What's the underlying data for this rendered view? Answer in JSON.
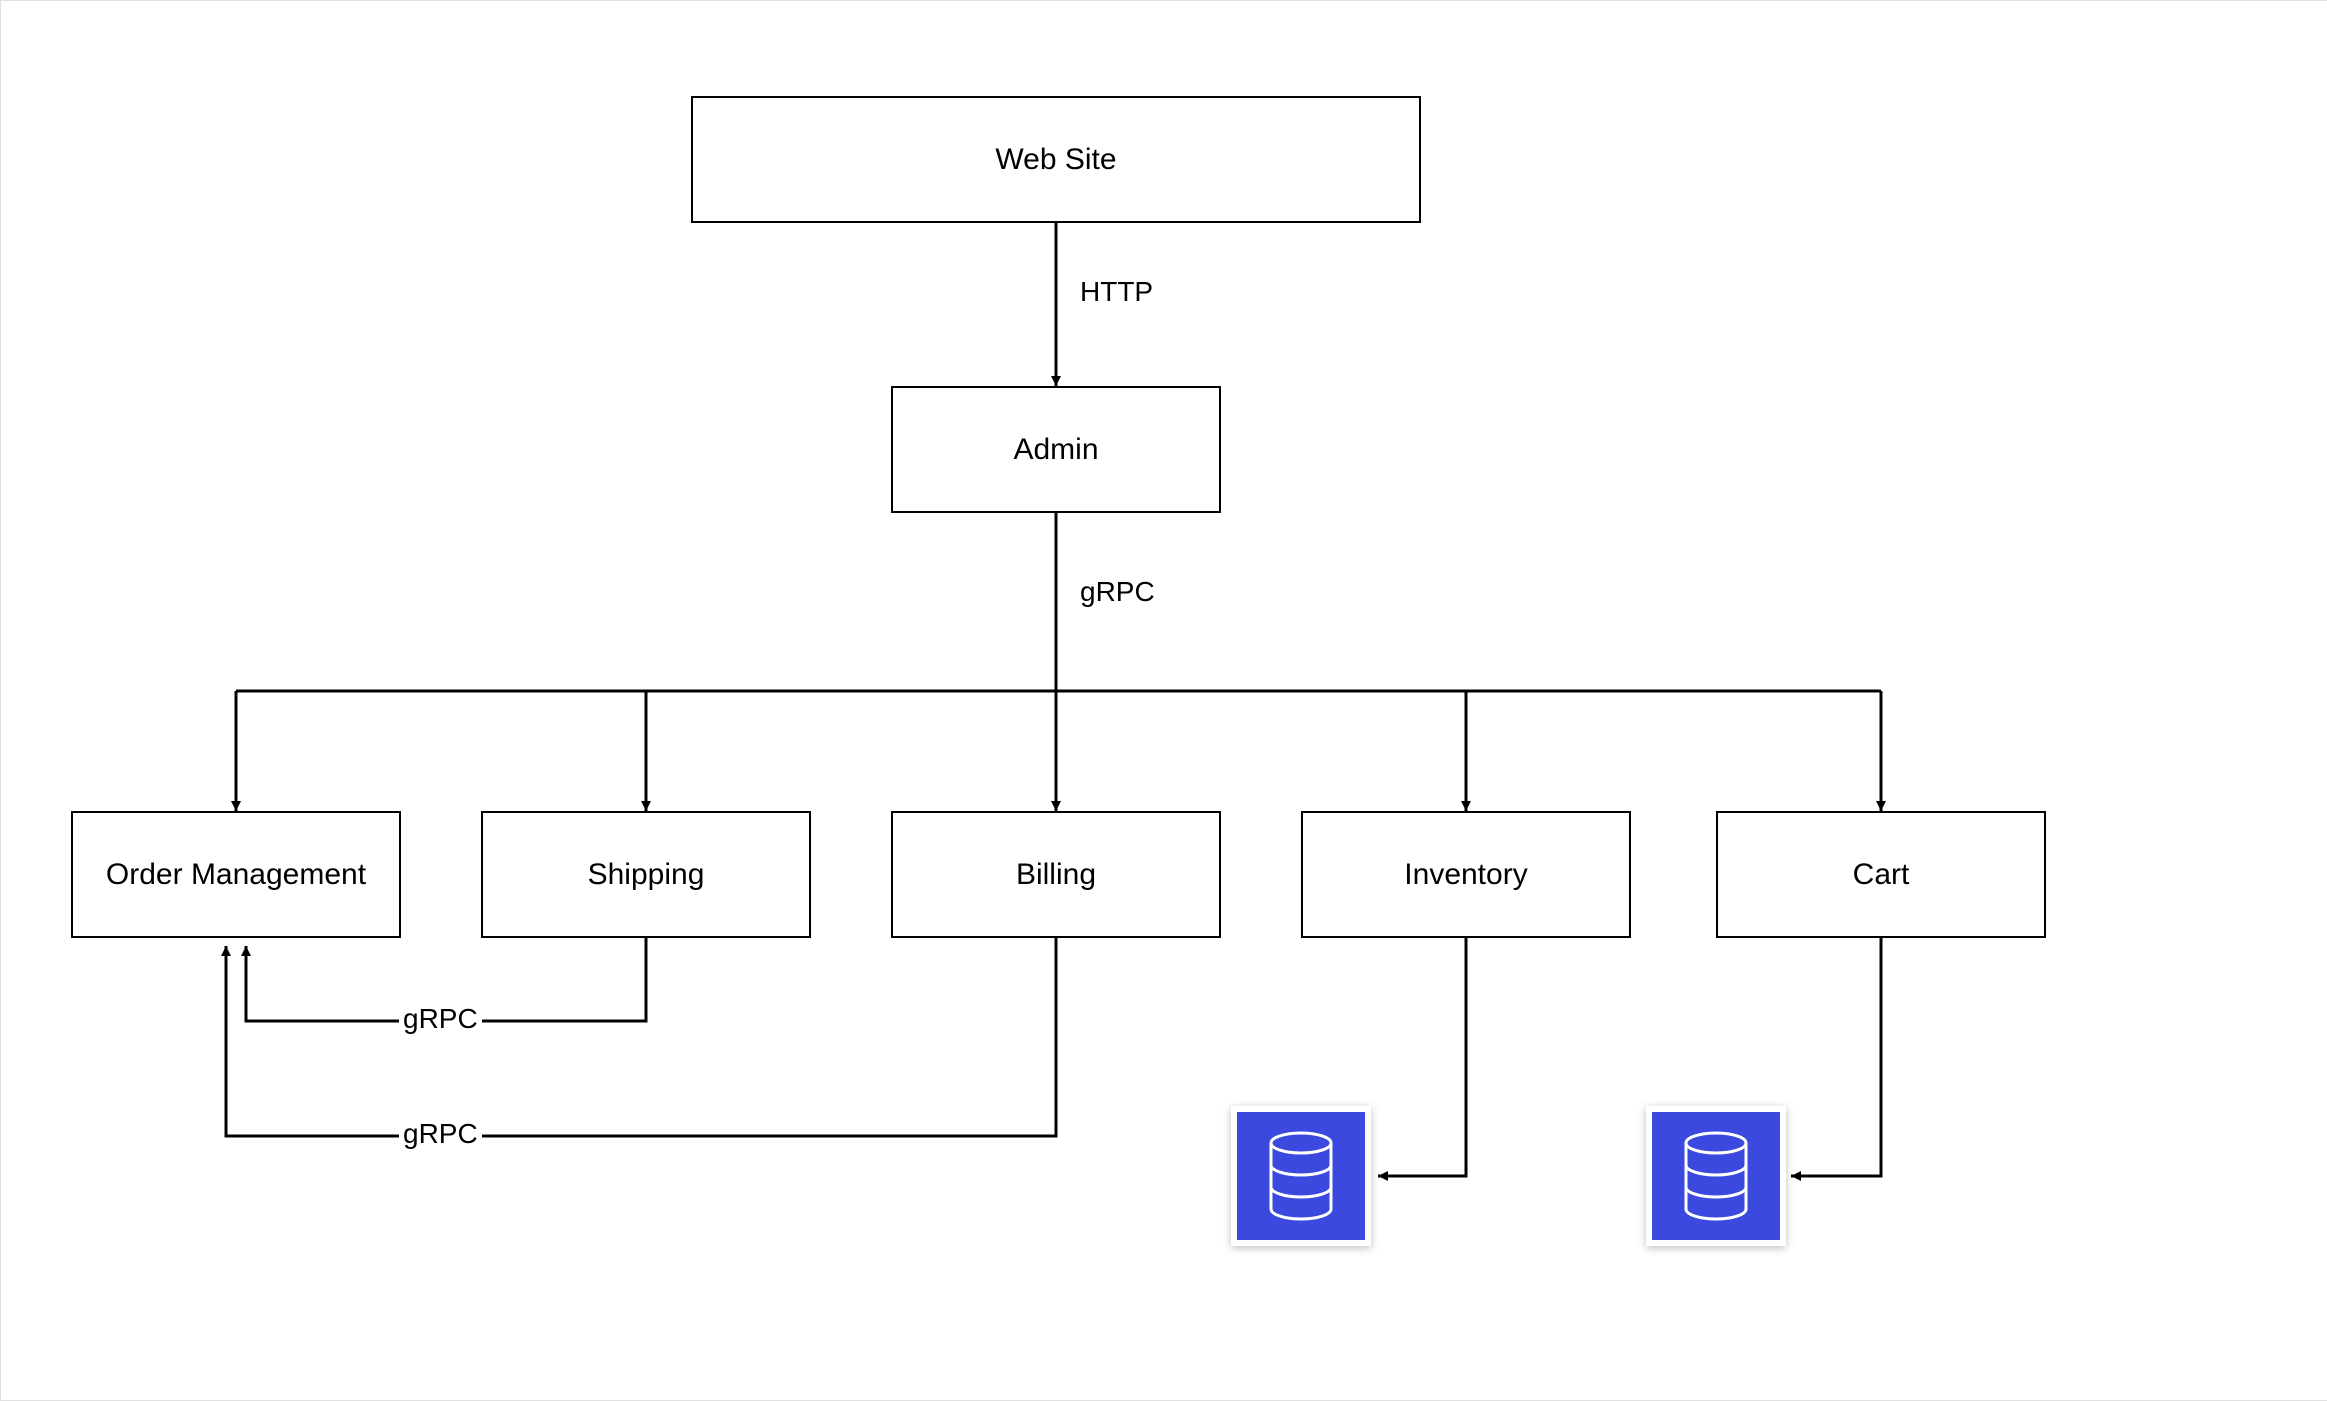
{
  "nodes": {
    "website": {
      "label": "Web Site"
    },
    "admin": {
      "label": "Admin"
    },
    "ordermgmt": {
      "label": "Order Management"
    },
    "shipping": {
      "label": "Shipping"
    },
    "billing": {
      "label": "Billing"
    },
    "inventory": {
      "label": "Inventory"
    },
    "cart": {
      "label": "Cart"
    }
  },
  "edges": {
    "website_admin": {
      "label": "HTTP"
    },
    "admin_fanout": {
      "label": "gRPC"
    },
    "shipping_ordermgmt": {
      "label": "gRPC"
    },
    "billing_ordermgmt": {
      "label": "gRPC"
    }
  },
  "icons": {
    "database": "database-icon"
  }
}
